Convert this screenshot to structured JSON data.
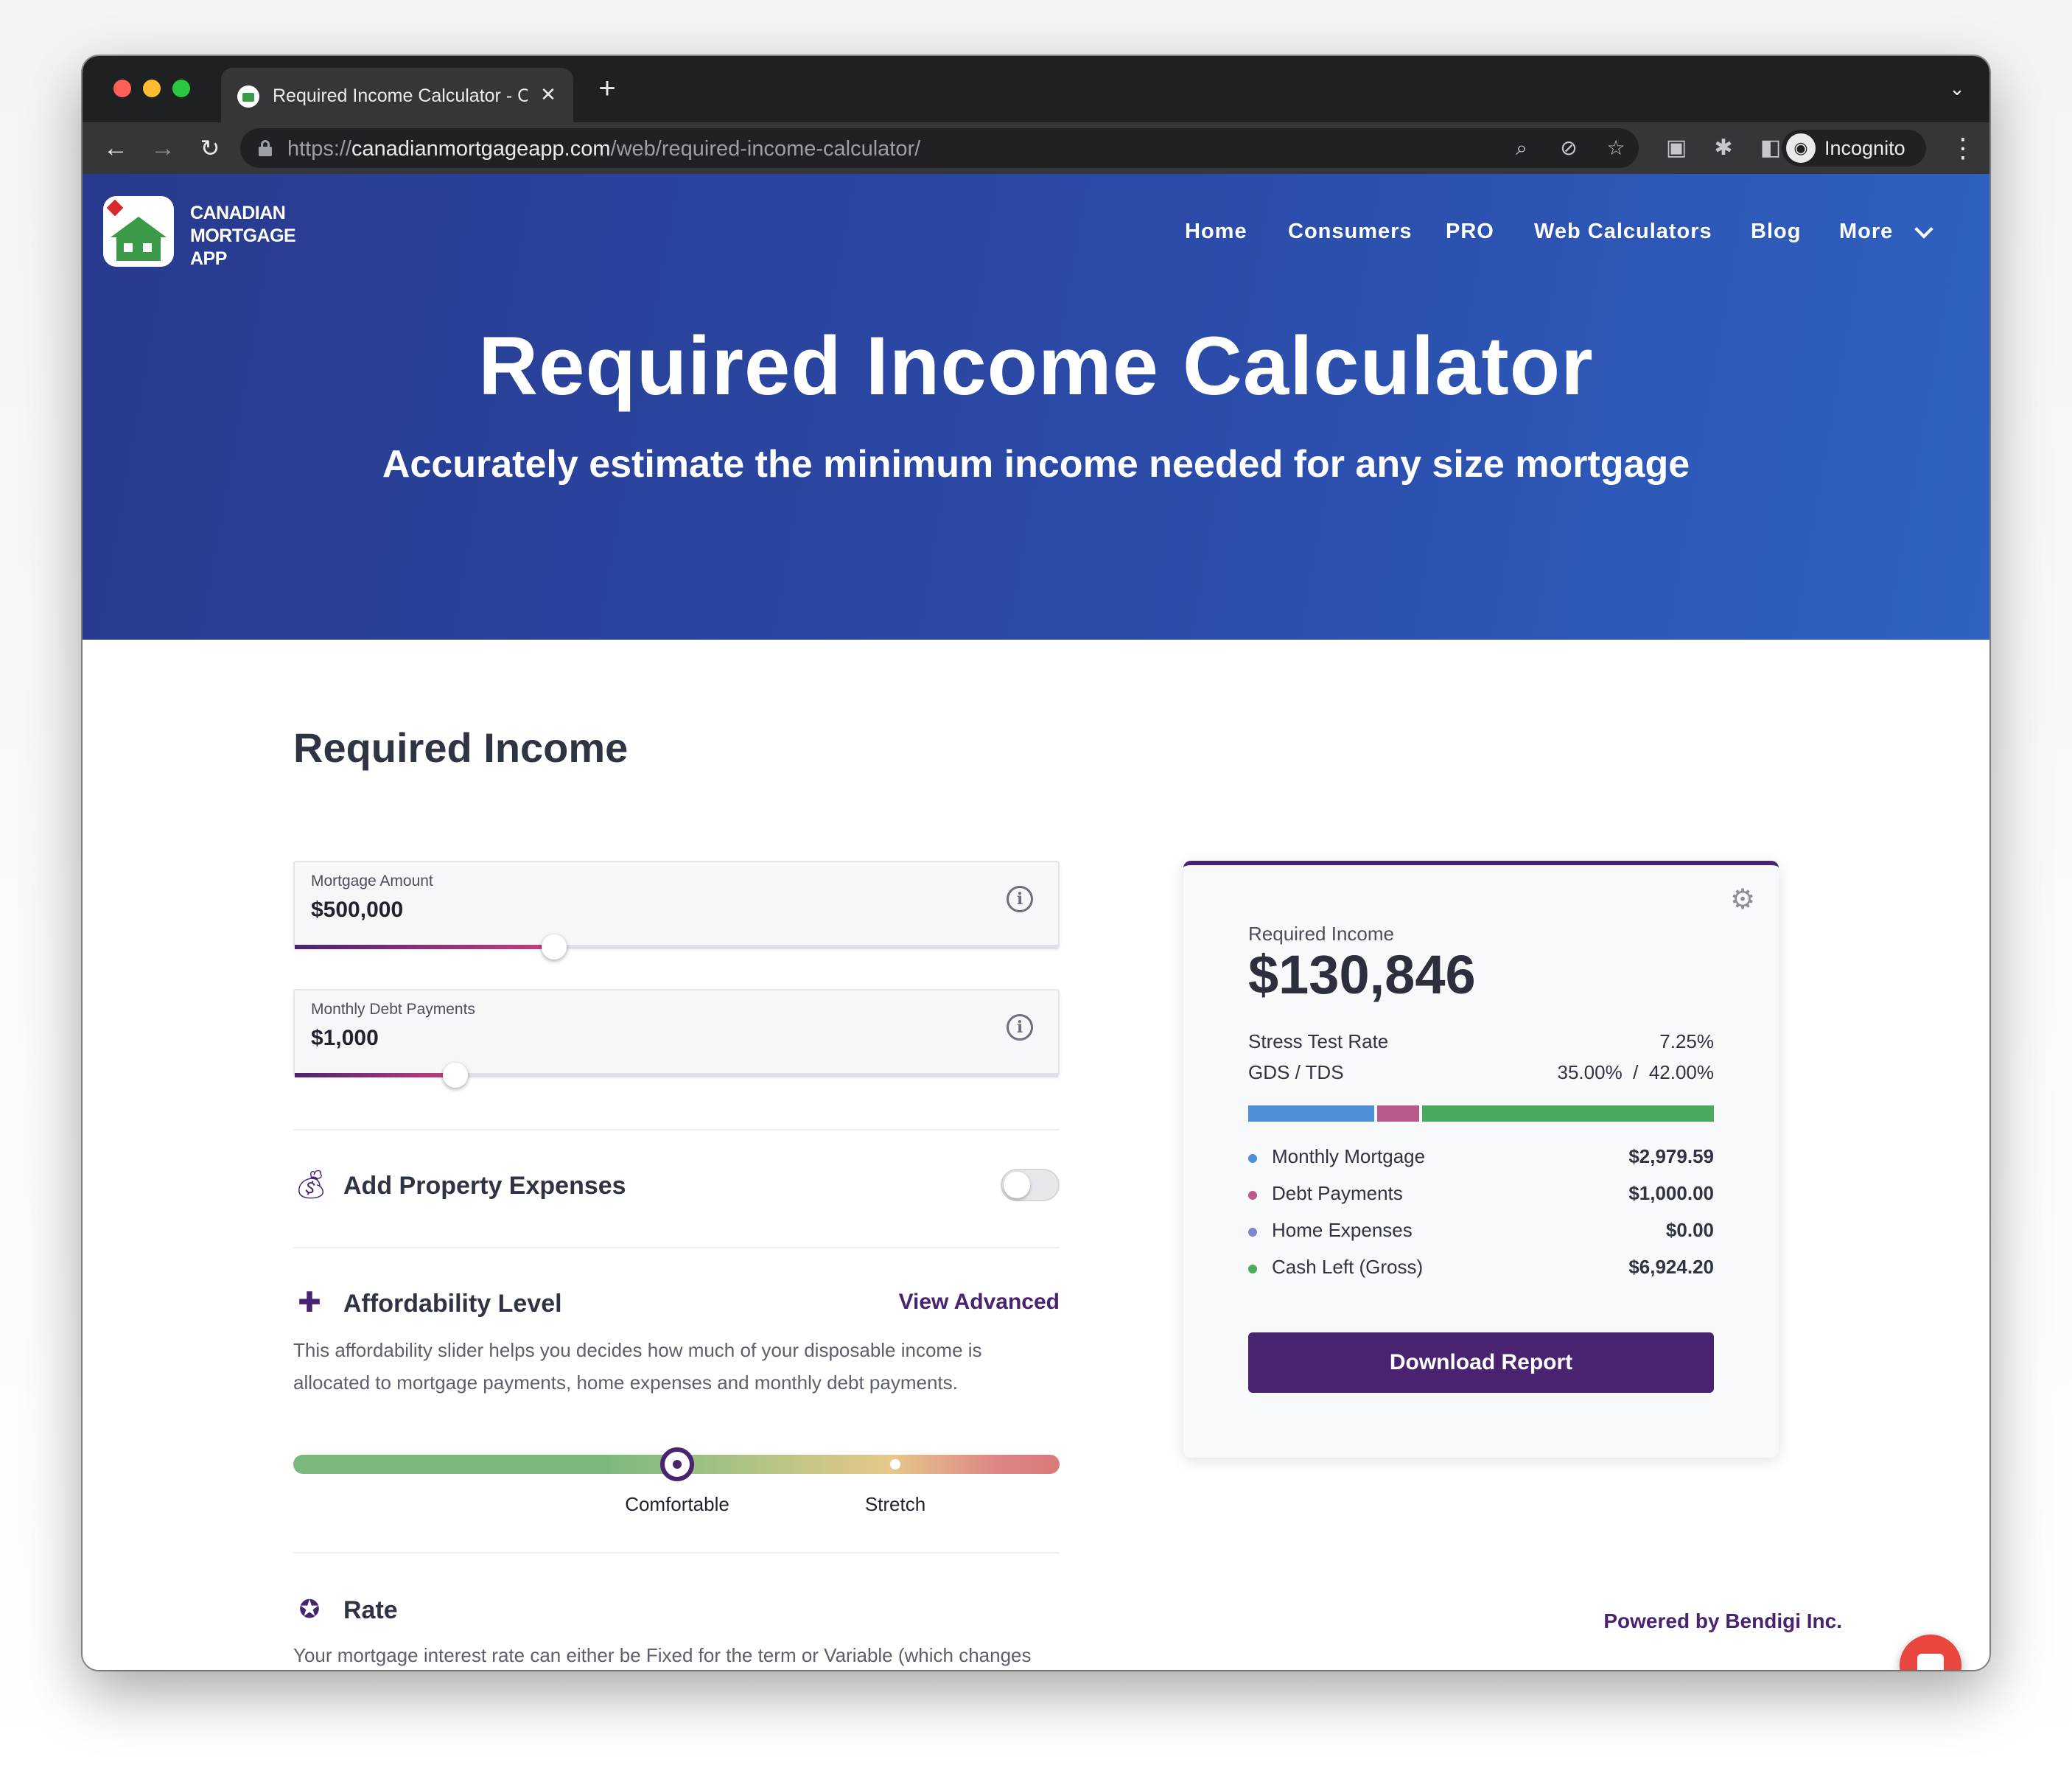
{
  "browser": {
    "tab_title": "Required Income Calculator - C",
    "url_scheme": "https://",
    "url_host": "canadianmortgageapp.com",
    "url_path": "/web/required-income-calculator/",
    "profile_label": "Incognito"
  },
  "site": {
    "logo_lines": [
      "CANADIAN",
      "MORTGAGE",
      "APP"
    ],
    "nav": [
      "Home",
      "Consumers",
      "PRO",
      "Web Calculators",
      "Blog",
      "More"
    ]
  },
  "hero": {
    "title": "Required Income Calculator",
    "subtitle": "Accurately estimate the minimum income needed for any size mortgage"
  },
  "form": {
    "section_title": "Required Income",
    "mortgage_amount": {
      "label": "Mortgage Amount",
      "value": "$500,000",
      "slider_fraction": 0.34
    },
    "monthly_debt": {
      "label": "Monthly Debt Payments",
      "value": "$1,000",
      "slider_fraction": 0.21
    },
    "property_expenses": {
      "title": "Add Property Expenses",
      "enabled": false
    },
    "affordability": {
      "title": "Affordability Level",
      "advanced_link": "View Advanced",
      "description": "This affordability slider helps you decides how much of your disposable income is allocated to mortgage payments, home expenses and monthly debt payments.",
      "labels": [
        "Comfortable",
        "Stretch"
      ],
      "level_fraction": 0.5
    },
    "rate": {
      "title": "Rate",
      "description": "Your mortgage interest rate can either be Fixed for the term or Variable (which changes with the prime rate). The Rate Term is the contract length with a lender."
    }
  },
  "result": {
    "label": "Required Income",
    "amount": "$130,846",
    "stress_test_label": "Stress Test Rate",
    "stress_test_value": "7.25%",
    "gds_tds_label": "GDS / TDS",
    "gds_tds_value": "35.00%  /  42.00%",
    "breakdown": [
      {
        "label": "Monthly Mortgage",
        "value": "$2,979.59",
        "amount": 2979.59,
        "color": "#4f8fd8"
      },
      {
        "label": "Debt Payments",
        "value": "$1,000.00",
        "amount": 1000.0,
        "color": "#b85a8a"
      },
      {
        "label": "Home Expenses",
        "value": "$0.00",
        "amount": 0,
        "color": "#7f86cf"
      },
      {
        "label": "Cash Left (Gross)",
        "value": "$6,924.20",
        "amount": 6924.2,
        "color": "#49a95c"
      }
    ],
    "download_label": "Download Report",
    "powered_by": "Powered by Bendigi Inc."
  },
  "colors": {
    "brand": "#4a2370",
    "hero_start": "#283a8e",
    "hero_end": "#2f62c2"
  }
}
